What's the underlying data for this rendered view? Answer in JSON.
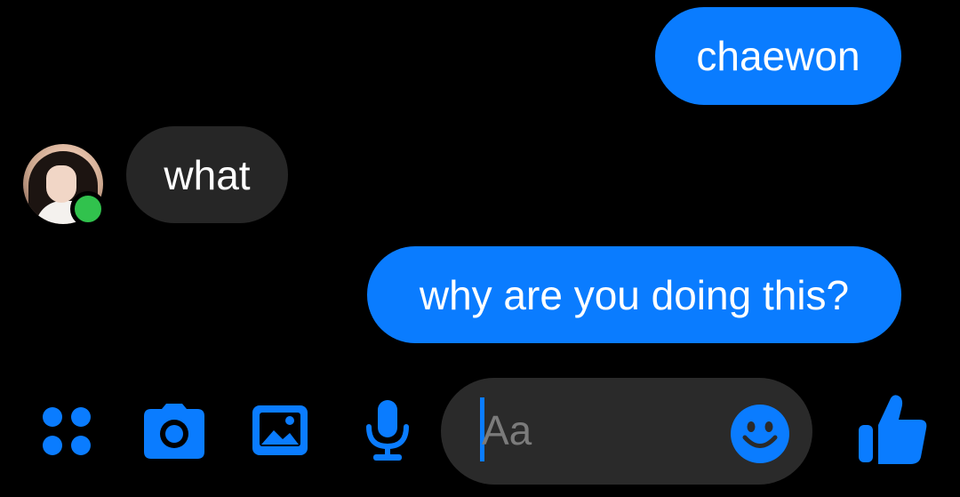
{
  "messages": [
    {
      "id": "msg-1",
      "direction": "sent",
      "text": "chaewon"
    },
    {
      "id": "msg-2",
      "direction": "received",
      "text": "what"
    },
    {
      "id": "msg-3",
      "direction": "sent",
      "text": "why are you doing this?"
    }
  ],
  "contact": {
    "online": true
  },
  "composer": {
    "placeholder": "Aa",
    "value": ""
  },
  "toolbar": {
    "icons": [
      "apps-icon",
      "camera-icon",
      "gallery-icon",
      "microphone-icon",
      "emoji-icon",
      "thumbs-up-icon"
    ]
  },
  "colors": {
    "background": "#000000",
    "sent_bubble": "#0a7cff",
    "received_bubble": "#262626",
    "composer_bg": "#2a2a2a",
    "accent": "#0a7cff",
    "presence": "#31c24d"
  }
}
